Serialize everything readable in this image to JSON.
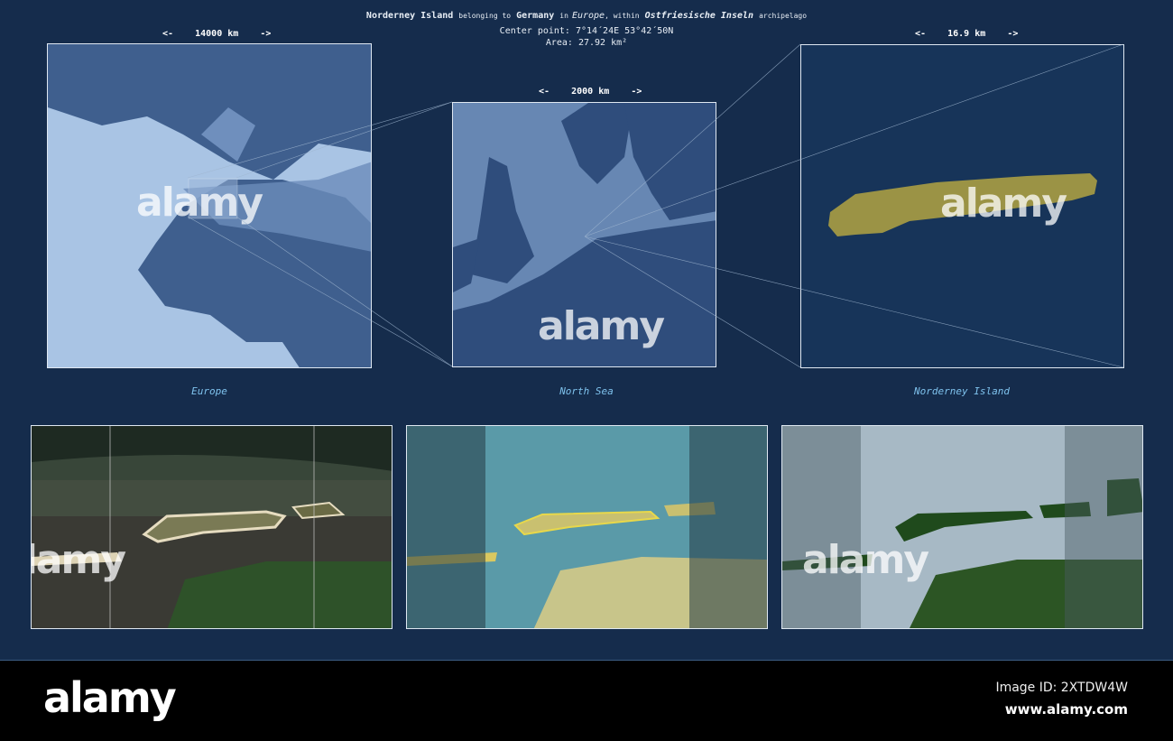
{
  "header": {
    "name": "Norderney Island",
    "belonging": "belonging to",
    "country": "Germany",
    "in": "in",
    "continent": "Europe",
    "within": ", within",
    "archipelago": "Ostfriesische Inseln",
    "archipelago_suffix": "archipelago",
    "center": "Center point: 7°14´24E  53°42´50N",
    "area": "Area: 27.92 km²"
  },
  "panels": [
    {
      "label": "Europe",
      "scale": "<-    14000 km    ->"
    },
    {
      "label": "North Sea",
      "scale": "<-    2000 km    ->"
    },
    {
      "label": "Norderney Island",
      "scale": "<-    16.9 km    ->"
    }
  ],
  "watermark": "alamy",
  "banner": {
    "logo": "alamy",
    "image_id": "Image ID: 2XTDW4W",
    "url": "www.alamy.com"
  },
  "colors": {
    "background": "#152c4c",
    "island": "#9b9345",
    "label": "#7fc3ee"
  }
}
